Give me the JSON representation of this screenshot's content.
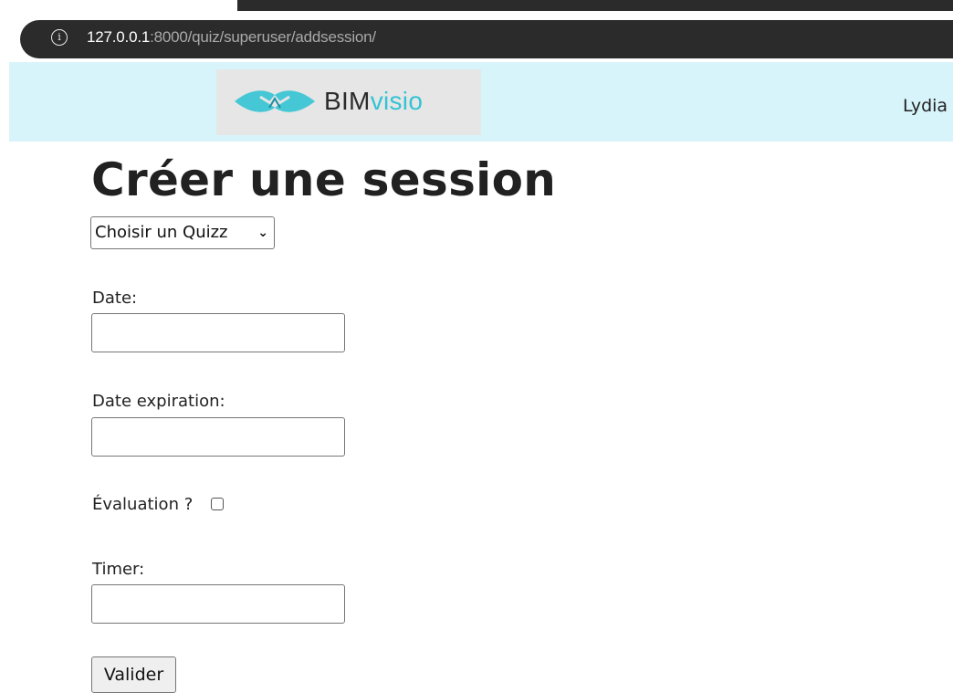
{
  "browser": {
    "url_host": "127.0.0.1",
    "url_rest": ":8000/quiz/superuser/addsession/",
    "info_icon": "info-icon"
  },
  "navbar": {
    "logo_bim": "BIM",
    "logo_visio": "visio",
    "user_name": "Lydia",
    "colors": {
      "navbar_bg": "#d8f4fb",
      "logo_accent": "#34c3d3"
    }
  },
  "form": {
    "title": "Créer une session",
    "quiz_select": {
      "selected": "Choisir un Quizz"
    },
    "date_label": "Date:",
    "date_value": "",
    "date_expiration_label": "Date expiration:",
    "date_expiration_value": "",
    "evaluation_label": "Évaluation ?",
    "evaluation_checked": false,
    "timer_label": "Timer:",
    "timer_value": "",
    "submit_label": "Valider"
  }
}
